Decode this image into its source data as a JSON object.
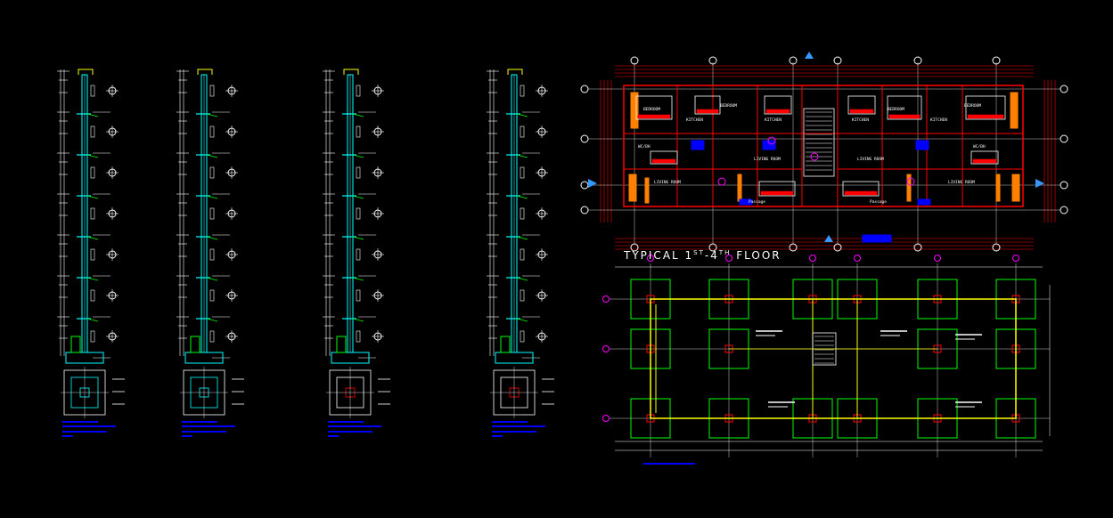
{
  "floor_plan_title": {
    "prefix": "TYPICAL 1",
    "sup1": "ST",
    "dash": "-4",
    "sup2": "TH",
    "suffix": " FLOOR"
  },
  "rooms_left": [
    "BEDROOM",
    "BEDROOM",
    "KITCHEN",
    "KITCHEN",
    "LIVING ROOM",
    "LIVING ROOM",
    "WC/BH",
    "Passage"
  ],
  "rooms_right": [
    "BEDROOM",
    "BEDROOM",
    "KITCHEN",
    "KITCHEN",
    "LIVING ROOM",
    "LIVING ROOM",
    "WC/BH",
    "Passage"
  ],
  "colors": {
    "background": "#000000",
    "cyan": "#00ffff",
    "yellow": "#ffff00",
    "green": "#00ff00",
    "red": "#ff0000",
    "orange": "#ff7f00",
    "blue": "#0000ff",
    "magenta": "#ff00ff",
    "white": "#ffffff",
    "grey": "#9a9a9a"
  }
}
